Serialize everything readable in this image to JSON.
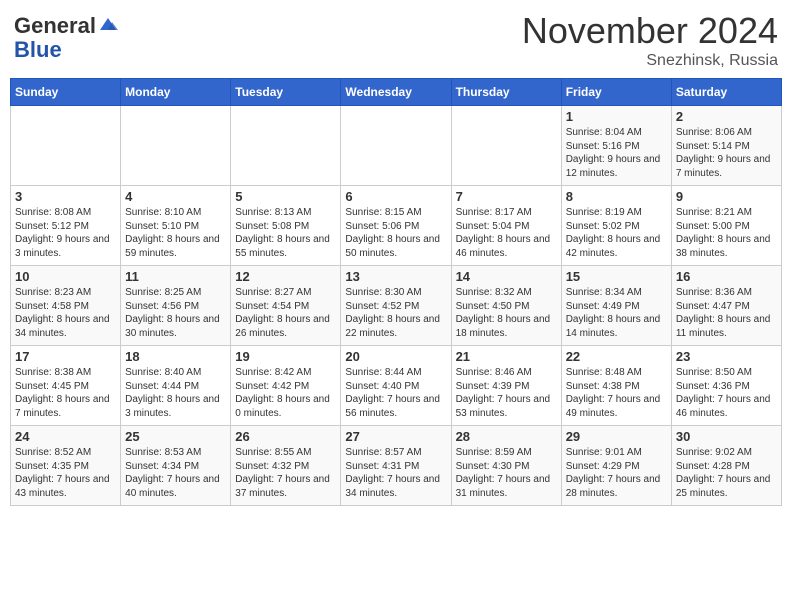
{
  "header": {
    "logo_general": "General",
    "logo_blue": "Blue",
    "month_title": "November 2024",
    "location": "Snezhinsk, Russia"
  },
  "days_of_week": [
    "Sunday",
    "Monday",
    "Tuesday",
    "Wednesday",
    "Thursday",
    "Friday",
    "Saturday"
  ],
  "weeks": [
    [
      {
        "day": "",
        "info": ""
      },
      {
        "day": "",
        "info": ""
      },
      {
        "day": "",
        "info": ""
      },
      {
        "day": "",
        "info": ""
      },
      {
        "day": "",
        "info": ""
      },
      {
        "day": "1",
        "info": "Sunrise: 8:04 AM\nSunset: 5:16 PM\nDaylight: 9 hours and 12 minutes."
      },
      {
        "day": "2",
        "info": "Sunrise: 8:06 AM\nSunset: 5:14 PM\nDaylight: 9 hours and 7 minutes."
      }
    ],
    [
      {
        "day": "3",
        "info": "Sunrise: 8:08 AM\nSunset: 5:12 PM\nDaylight: 9 hours and 3 minutes."
      },
      {
        "day": "4",
        "info": "Sunrise: 8:10 AM\nSunset: 5:10 PM\nDaylight: 8 hours and 59 minutes."
      },
      {
        "day": "5",
        "info": "Sunrise: 8:13 AM\nSunset: 5:08 PM\nDaylight: 8 hours and 55 minutes."
      },
      {
        "day": "6",
        "info": "Sunrise: 8:15 AM\nSunset: 5:06 PM\nDaylight: 8 hours and 50 minutes."
      },
      {
        "day": "7",
        "info": "Sunrise: 8:17 AM\nSunset: 5:04 PM\nDaylight: 8 hours and 46 minutes."
      },
      {
        "day": "8",
        "info": "Sunrise: 8:19 AM\nSunset: 5:02 PM\nDaylight: 8 hours and 42 minutes."
      },
      {
        "day": "9",
        "info": "Sunrise: 8:21 AM\nSunset: 5:00 PM\nDaylight: 8 hours and 38 minutes."
      }
    ],
    [
      {
        "day": "10",
        "info": "Sunrise: 8:23 AM\nSunset: 4:58 PM\nDaylight: 8 hours and 34 minutes."
      },
      {
        "day": "11",
        "info": "Sunrise: 8:25 AM\nSunset: 4:56 PM\nDaylight: 8 hours and 30 minutes."
      },
      {
        "day": "12",
        "info": "Sunrise: 8:27 AM\nSunset: 4:54 PM\nDaylight: 8 hours and 26 minutes."
      },
      {
        "day": "13",
        "info": "Sunrise: 8:30 AM\nSunset: 4:52 PM\nDaylight: 8 hours and 22 minutes."
      },
      {
        "day": "14",
        "info": "Sunrise: 8:32 AM\nSunset: 4:50 PM\nDaylight: 8 hours and 18 minutes."
      },
      {
        "day": "15",
        "info": "Sunrise: 8:34 AM\nSunset: 4:49 PM\nDaylight: 8 hours and 14 minutes."
      },
      {
        "day": "16",
        "info": "Sunrise: 8:36 AM\nSunset: 4:47 PM\nDaylight: 8 hours and 11 minutes."
      }
    ],
    [
      {
        "day": "17",
        "info": "Sunrise: 8:38 AM\nSunset: 4:45 PM\nDaylight: 8 hours and 7 minutes."
      },
      {
        "day": "18",
        "info": "Sunrise: 8:40 AM\nSunset: 4:44 PM\nDaylight: 8 hours and 3 minutes."
      },
      {
        "day": "19",
        "info": "Sunrise: 8:42 AM\nSunset: 4:42 PM\nDaylight: 8 hours and 0 minutes."
      },
      {
        "day": "20",
        "info": "Sunrise: 8:44 AM\nSunset: 4:40 PM\nDaylight: 7 hours and 56 minutes."
      },
      {
        "day": "21",
        "info": "Sunrise: 8:46 AM\nSunset: 4:39 PM\nDaylight: 7 hours and 53 minutes."
      },
      {
        "day": "22",
        "info": "Sunrise: 8:48 AM\nSunset: 4:38 PM\nDaylight: 7 hours and 49 minutes."
      },
      {
        "day": "23",
        "info": "Sunrise: 8:50 AM\nSunset: 4:36 PM\nDaylight: 7 hours and 46 minutes."
      }
    ],
    [
      {
        "day": "24",
        "info": "Sunrise: 8:52 AM\nSunset: 4:35 PM\nDaylight: 7 hours and 43 minutes."
      },
      {
        "day": "25",
        "info": "Sunrise: 8:53 AM\nSunset: 4:34 PM\nDaylight: 7 hours and 40 minutes."
      },
      {
        "day": "26",
        "info": "Sunrise: 8:55 AM\nSunset: 4:32 PM\nDaylight: 7 hours and 37 minutes."
      },
      {
        "day": "27",
        "info": "Sunrise: 8:57 AM\nSunset: 4:31 PM\nDaylight: 7 hours and 34 minutes."
      },
      {
        "day": "28",
        "info": "Sunrise: 8:59 AM\nSunset: 4:30 PM\nDaylight: 7 hours and 31 minutes."
      },
      {
        "day": "29",
        "info": "Sunrise: 9:01 AM\nSunset: 4:29 PM\nDaylight: 7 hours and 28 minutes."
      },
      {
        "day": "30",
        "info": "Sunrise: 9:02 AM\nSunset: 4:28 PM\nDaylight: 7 hours and 25 minutes."
      }
    ]
  ]
}
